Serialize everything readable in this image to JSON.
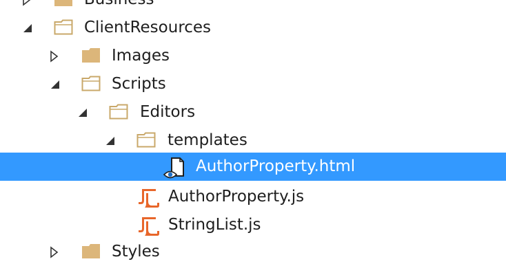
{
  "tree": {
    "items": [
      {
        "label": "Business",
        "expanded": false,
        "icon": "folder-closed-icon"
      },
      {
        "label": "ClientResources",
        "expanded": true,
        "icon": "folder-open-icon"
      },
      {
        "label": "Images",
        "expanded": false,
        "icon": "folder-closed-icon"
      },
      {
        "label": "Scripts",
        "expanded": true,
        "icon": "folder-open-icon"
      },
      {
        "label": "Editors",
        "expanded": true,
        "icon": "folder-open-icon"
      },
      {
        "label": "templates",
        "expanded": true,
        "icon": "folder-open-icon"
      },
      {
        "label": "AuthorProperty.html",
        "selected": true,
        "icon": "html-file-icon"
      },
      {
        "label": "AuthorProperty.js",
        "icon": "js-file-icon"
      },
      {
        "label": "StringList.js",
        "icon": "js-file-icon"
      },
      {
        "label": "Styles",
        "expanded": false,
        "icon": "folder-closed-icon"
      }
    ]
  },
  "colors": {
    "selection": "#3399ff",
    "folder": "#dcb67a",
    "js_icon": "#e8662a",
    "text": "#1e1e1e"
  }
}
